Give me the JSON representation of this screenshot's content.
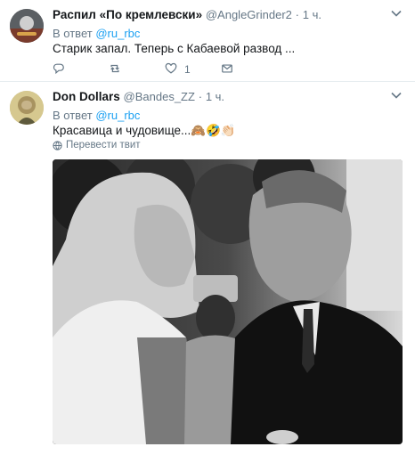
{
  "tweets": [
    {
      "author_name": "Распил «По кремлевски»",
      "handle": "@AngleGrinder2",
      "separator": "·",
      "time": "1 ч.",
      "reply_prefix": "В ответ",
      "reply_mention": "@ru_rbc",
      "text": "Старик запал. Теперь с Кабаевой развод ...",
      "actions": {
        "reply_count": "",
        "retweet_count": "",
        "like_count": "1"
      }
    },
    {
      "author_name": "Don Dollars",
      "handle": "@Bandes_ZZ",
      "separator": "·",
      "time": "1 ч.",
      "reply_prefix": "В ответ",
      "reply_mention": "@ru_rbc",
      "text": "Красавица и чудовище...🙈🤣👏🏻",
      "translate_label": "Перевести твит"
    }
  ],
  "colors": {
    "link": "#1da1f2",
    "secondary": "#657786",
    "primary_text": "#14171a",
    "border": "#e6ecf0"
  },
  "icons": [
    "caret-down-icon",
    "reply-icon",
    "retweet-icon",
    "like-icon",
    "dm-icon",
    "globe-icon"
  ]
}
